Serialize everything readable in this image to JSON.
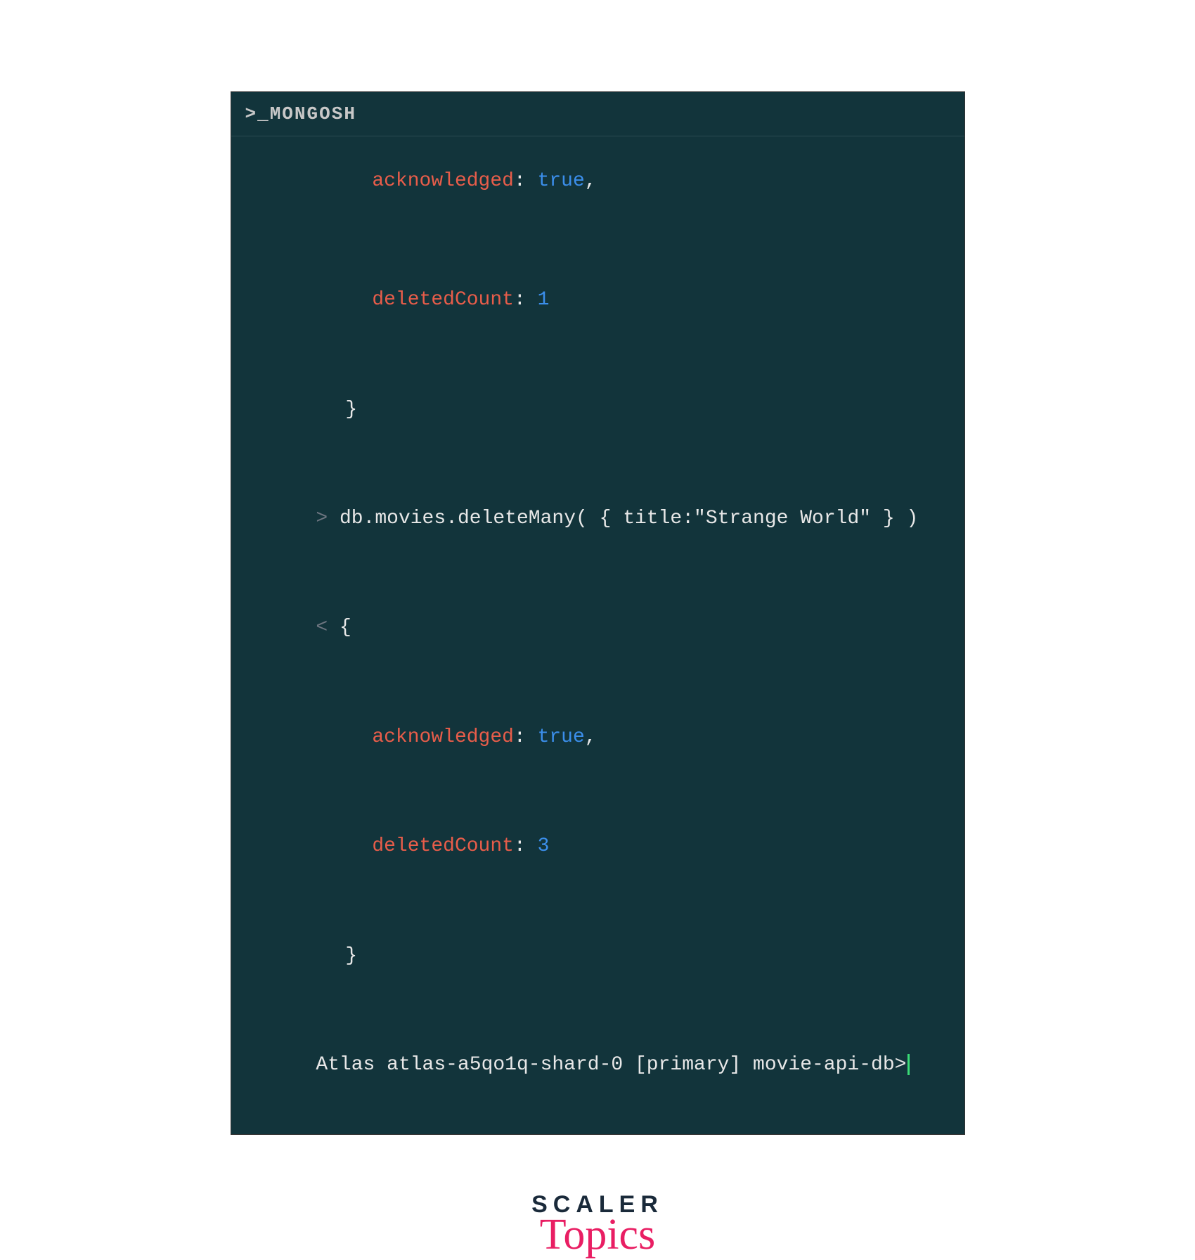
{
  "header": {
    "title": ">_MONGOSH"
  },
  "output": {
    "prev": {
      "key1": "acknowledged",
      "val1": "true",
      "key2": "deletedCount",
      "val2": "1",
      "close": "}"
    },
    "command": "db.movies.deleteMany( { title:\"Strange World\" } )",
    "result": {
      "open": "{",
      "key1": "acknowledged",
      "val1": "true",
      "key2": "deletedCount",
      "val2": "3",
      "close": "}"
    },
    "prompt": "Atlas atlas-a5qo1q-shard-0 [primary] movie-api-db>"
  },
  "logo": {
    "line1": "SCALER",
    "line2": "Topics"
  },
  "colors": {
    "bg": "#12343b",
    "key": "#e85d4a",
    "value": "#3b8eea",
    "text": "#e8e8e8",
    "brand": "#e91e63"
  }
}
